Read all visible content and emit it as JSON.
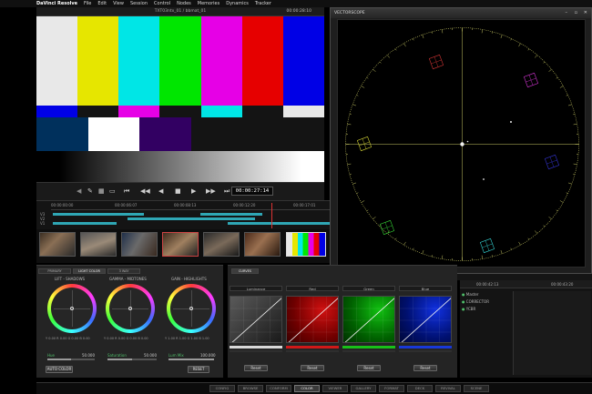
{
  "app": {
    "name": "DaVinci Resolve",
    "menu": [
      "File",
      "Edit",
      "View",
      "Session",
      "Control",
      "Nodes",
      "Memories",
      "Dynamics",
      "Tracker"
    ]
  },
  "viewer": {
    "clip_title": "TXT03ntx_01 / bbmat_01",
    "timecode_top": "00:00:28:10",
    "timecode": "00:00:27:14"
  },
  "colors": {
    "bars_top": [
      "#e8e8e8",
      "#e6e600",
      "#00e6e6",
      "#00e600",
      "#e600e6",
      "#e60000",
      "#0000e6"
    ],
    "bars_mid": [
      "#0000e6",
      "#141414",
      "#e600e6",
      "#141414",
      "#00e6e6",
      "#141414",
      "#e8e8e8"
    ],
    "accent": "#2fa7b5",
    "scope_trace": "#c8c864"
  },
  "timeline": {
    "ticks": [
      "00:00:00:00",
      "00:00:06:07",
      "00:00:08:13",
      "00:00:12:20",
      "00:00:17:01"
    ],
    "tracks": [
      "V3",
      "V2",
      "V1"
    ]
  },
  "scope": {
    "title": "VECTORSCOPE",
    "window_buttons": [
      "minimize-icon",
      "maximize-icon",
      "close-icon"
    ]
  },
  "color_panel": {
    "tabs": [
      "PRIMARY",
      "LIGHT COLOR",
      "3 WAY"
    ],
    "wheels": [
      {
        "label": "LIFT - SHADOWS",
        "rgb": "Y 0.00   R 0.00   G 0.00   B 0.00"
      },
      {
        "label": "GAMMA - MIDTONES",
        "rgb": "Y 0.00   R 0.00   G 0.00   B 0.00"
      },
      {
        "label": "GAIN - HIGHLIGHTS",
        "rgb": "Y 1.00   R 1.00   G 1.00   B 1.00"
      }
    ],
    "sliders": [
      {
        "label": "Hue",
        "value": "50.000",
        "level": 0.5
      },
      {
        "label": "Saturation",
        "value": "50.000",
        "level": 0.5
      },
      {
        "label": "Lum Mix",
        "value": "100.000",
        "level": 1.0
      }
    ],
    "auto_color": "AUTO COLOR",
    "reset": "RESET"
  },
  "curves": {
    "tab": "CURVES",
    "channels": [
      {
        "label": "Luminance",
        "reset": "Reset"
      },
      {
        "label": "Red",
        "reset": "Reset"
      },
      {
        "label": "Green",
        "reset": "Reset"
      },
      {
        "label": "Blue",
        "reset": "Reset"
      }
    ]
  },
  "nodes": {
    "ruler": [
      "00:00:42:13",
      "00:00:43:20"
    ],
    "rows": [
      {
        "flag": "●",
        "name": "Master"
      },
      {
        "flag": "●",
        "name": "CORRECTOR"
      },
      {
        "flag": "●",
        "name": "YCBR"
      }
    ]
  },
  "pages": [
    "CONFIG",
    "BROWSE",
    "CONFORM",
    "COLOR",
    "VIEWER",
    "GALLERY",
    "FORMAT",
    "DECK",
    "REVIVAL",
    "SCENE"
  ],
  "active_page": "COLOR"
}
